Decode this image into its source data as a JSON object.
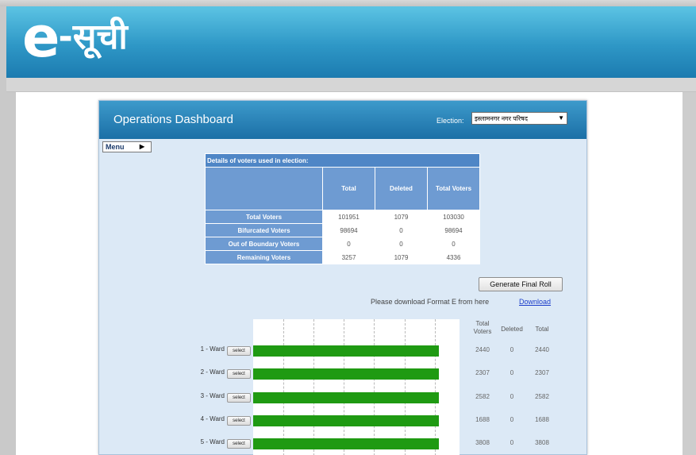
{
  "app": {
    "logo_e": "e",
    "logo_rest": "-सूची"
  },
  "dashboard": {
    "title": "Operations Dashboard",
    "election_label": "Election:",
    "election_value": "इस्लामनगर नगर परिषद",
    "menu_label": "Menu"
  },
  "details": {
    "title": "Details of voters used in election:",
    "headers": [
      "Total",
      "Deleted",
      "Total Voters"
    ],
    "rows": [
      {
        "label": "Total Voters",
        "values": [
          "101951",
          "1079",
          "103030"
        ]
      },
      {
        "label": "Bifurcated Voters",
        "values": [
          "98694",
          "0",
          "98694"
        ]
      },
      {
        "label": "Out of Boundary Voters",
        "values": [
          "0",
          "0",
          "0"
        ]
      },
      {
        "label": "Remaining Voters",
        "values": [
          "3257",
          "1079",
          "4336"
        ]
      }
    ]
  },
  "actions": {
    "generate_label": "Generate Final Roll",
    "download_text": "Please download Format E from here",
    "download_link": "Download"
  },
  "ward_table": {
    "headers": [
      "Total Voters",
      "Deleted",
      "Total"
    ],
    "select_label": "select"
  },
  "chart_data": {
    "type": "bar",
    "orientation": "horizontal",
    "categories": [
      "1 - Ward",
      "2 - Ward",
      "3 - Ward",
      "4 - Ward",
      "5 - Ward"
    ],
    "values": [
      100,
      100,
      100,
      100,
      100
    ],
    "bar_color": "#1f9a12",
    "grid": true,
    "rows": [
      {
        "total_voters": "2440",
        "deleted": "0",
        "total": "2440"
      },
      {
        "total_voters": "2307",
        "deleted": "0",
        "total": "2307"
      },
      {
        "total_voters": "2582",
        "deleted": "0",
        "total": "2582"
      },
      {
        "total_voters": "1688",
        "deleted": "0",
        "total": "1688"
      },
      {
        "total_voters": "3808",
        "deleted": "0",
        "total": "3808"
      }
    ]
  },
  "colors": {
    "header_blue": "#2e97c6",
    "panel_bg": "#dce9f6",
    "table_header": "#6e9bd2",
    "bar_green": "#1f9a12",
    "link": "#1a3cc9"
  }
}
